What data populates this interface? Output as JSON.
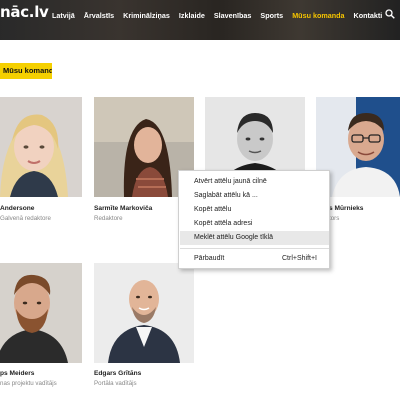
{
  "header": {
    "logo": "nāc.lv",
    "nav": [
      "Latvijā",
      "Ārvalstīs",
      "Kriminālziņas",
      "Izklaide",
      "Slavenības",
      "Sports",
      "Mūsu komanda",
      "Kontakti"
    ],
    "active_nav": "Mūsu komanda",
    "search_icon": "search-icon"
  },
  "section": {
    "title": "Mūsu komanda"
  },
  "team": [
    {
      "name": "Andersone",
      "role": "Galvenā redaktore"
    },
    {
      "name": "Sarmīte Markoviča",
      "role": "Redaktore"
    },
    {
      "name": "s Mūrnieks",
      "role": "tors"
    },
    {
      "name": "ps Meiders",
      "role": "nas projektu vadītājs"
    },
    {
      "name": "Edgars Grītāns",
      "role": "Portāla vadītājs"
    }
  ],
  "context_menu": {
    "items": [
      {
        "label": "Atvērt attēlu jaunā cilnē"
      },
      {
        "label": "Saglabāt attēlu kā ..."
      },
      {
        "label": "Kopēt attēlu"
      },
      {
        "label": "Kopēt attēla adresi"
      },
      {
        "label": "Meklēt attēlu Google tīklā"
      },
      {
        "label": "Pārbaudīt",
        "shortcut": "Ctrl+Shift+I"
      }
    ],
    "highlighted": "Meklēt attēlu Google tīklā"
  },
  "colors": {
    "accent": "#f5c400",
    "tag_bg": "#f5d000",
    "header_bg": "#1b1b1b"
  }
}
